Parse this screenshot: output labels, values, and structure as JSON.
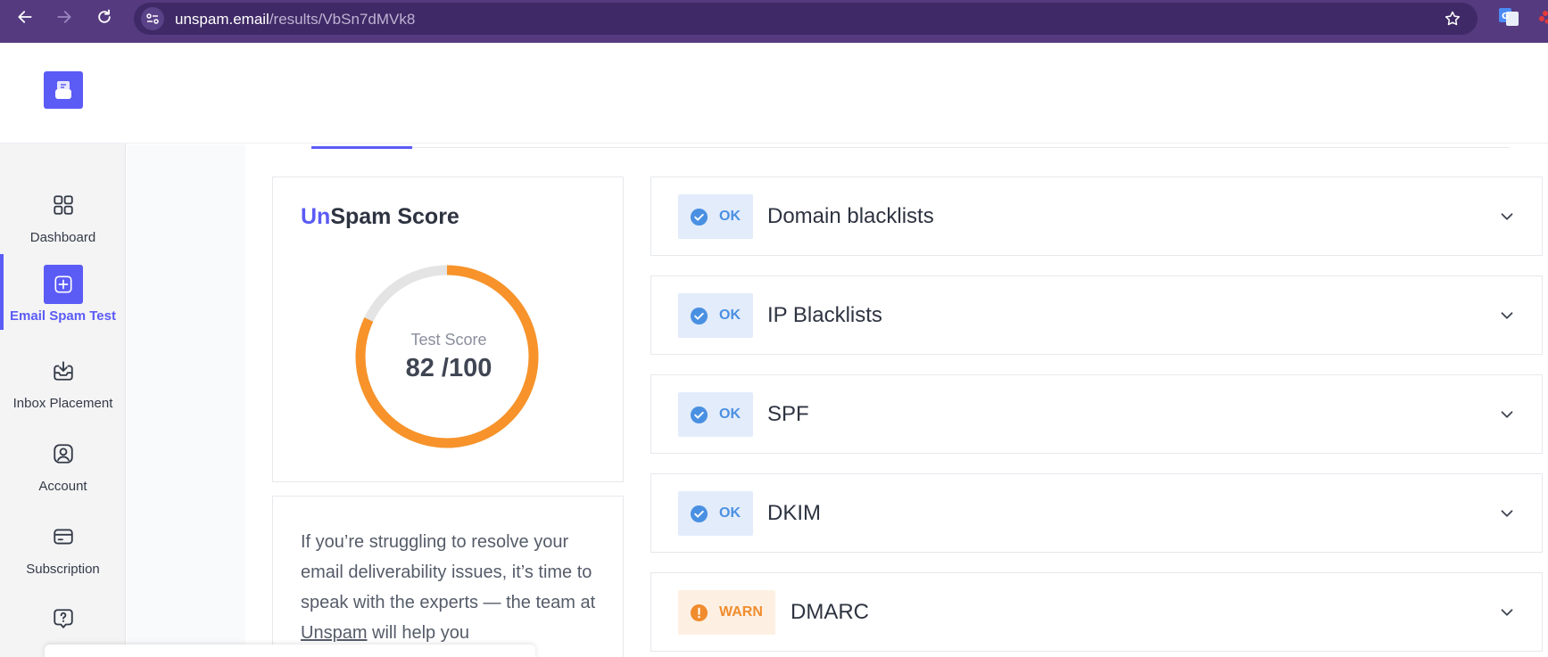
{
  "browser": {
    "url_host": "unspam.email",
    "url_path": "/results/VbSn7dMVk8",
    "icons": [
      "back-arrow-icon",
      "forward-arrow-icon",
      "reload-icon",
      "site-settings-icon",
      "bookmark-star-icon",
      "translate-extension-icon"
    ]
  },
  "sidebar": {
    "items": [
      {
        "label": "Dashboard",
        "icon": "grid-icon",
        "active": false
      },
      {
        "label": "Email Spam Test",
        "icon": "plus-square-icon",
        "active": true
      },
      {
        "label": "Inbox Placement",
        "icon": "inbox-download-icon",
        "active": false
      },
      {
        "label": "Account",
        "icon": "user-circle-icon",
        "active": false
      },
      {
        "label": "Subscription",
        "icon": "credit-card-icon",
        "active": false
      },
      {
        "label": "",
        "icon": "help-chat-icon",
        "active": false
      }
    ]
  },
  "score": {
    "title_accent": "Un",
    "title_rest": "Spam Score",
    "gauge_label": "Test Score",
    "gauge_value": "82 /100",
    "value": 82,
    "max": 100,
    "color": "#f7932a",
    "track_color": "#e4e4e4"
  },
  "help": {
    "text_before": "If you’re struggling to resolve your email deliverability issues, it’s time to speak with the experts — the team at ",
    "link": "Unspam",
    "text_after": " will help you"
  },
  "checks": [
    {
      "status": "OK",
      "name": "Domain blacklists"
    },
    {
      "status": "OK",
      "name": "IP Blacklists"
    },
    {
      "status": "OK",
      "name": "SPF"
    },
    {
      "status": "OK",
      "name": "DKIM"
    },
    {
      "status": "WARN",
      "name": "DMARC"
    }
  ],
  "colors": {
    "accent": "#5b5bf6",
    "chrome": "#553a80",
    "ok": "#4a90e2",
    "warn": "#f08c2e"
  }
}
